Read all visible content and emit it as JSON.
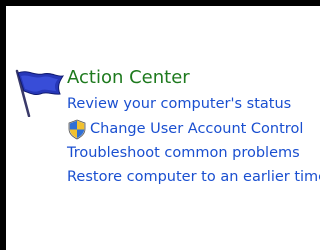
{
  "action_center": {
    "title": "Action Center",
    "links": [
      "Review your computer's status",
      "Change User Account Control",
      "Troubleshoot common problems",
      "Restore computer to an earlier time"
    ]
  },
  "icons": {
    "flag": "action-center-flag-icon",
    "shield": "uac-shield-icon"
  },
  "colors": {
    "title": "#1e7a1e",
    "link": "#1a4fd0"
  }
}
